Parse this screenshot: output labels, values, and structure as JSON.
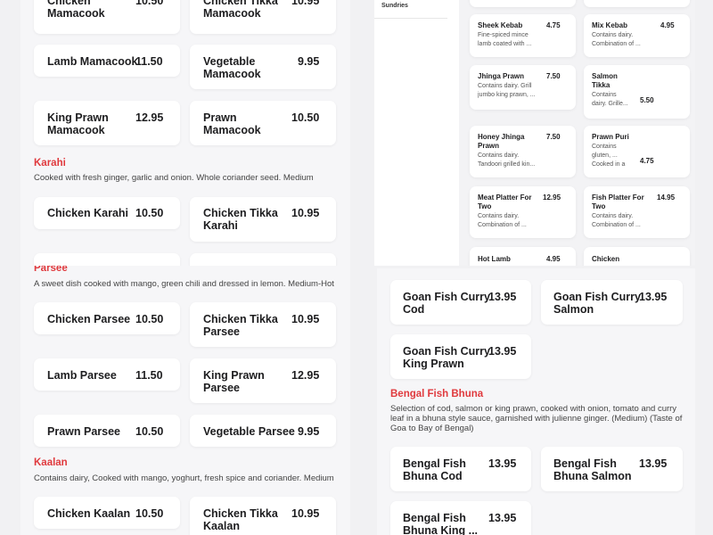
{
  "top_left": {
    "cards": [
      {
        "name": "Chicken\nMamacook",
        "price": "10.50"
      },
      {
        "name": "Chicken Tikka\nMamacook",
        "price": "10.95"
      },
      {
        "name": "Lamb Mamacook",
        "price": "11.50"
      },
      {
        "name": "Vegetable\nMamacook",
        "price": "9.95"
      },
      {
        "name": "King Prawn\nMamacook",
        "price": "12.95"
      },
      {
        "name": "Prawn\nMamacook",
        "price": "10.50"
      },
      {
        "name": "Chicken Karahi",
        "price": "10.50"
      },
      {
        "name": "Chicken Tikka\nKarahi",
        "price": "10.95"
      }
    ],
    "karahi": {
      "title": "Karahi",
      "desc": "Cooked with fresh ginger, garlic and onion. Whole coriander seed. Medium"
    }
  },
  "nav": {
    "item": "Sundries"
  },
  "top_right": {
    "cards": [
      {
        "name": "Sheek Kebab",
        "price": "4.75",
        "desc": "Fine-spiced mince\nlamb coated with ..."
      },
      {
        "name": "Mix Kebab",
        "price": "4.95",
        "desc": "Contains dairy.\nCombination of ..."
      },
      {
        "name": "Jhinga Prawn",
        "price": "7.50",
        "desc": "Contains dairy. Grill\njumbo king prawn, ..."
      },
      {
        "name": "Salmon\nTikka",
        "price": "5.50",
        "desc": "Contains\ndairy. Grille..."
      },
      {
        "name": "Honey Jhinga\nPrawn",
        "price": "7.50",
        "desc": "Contains dairy.\nTandoori grilled kin..."
      },
      {
        "name": "Prawn Puri",
        "price": "4.75",
        "desc": "Contains\ngluten, ...\nCooked in a"
      },
      {
        "name": "Meat Platter For\nTwo",
        "price": "12.95",
        "desc": "Contains dairy.\nCombination of ..."
      },
      {
        "name": "Fish Platter For\nTwo",
        "price": "14.95",
        "desc": "Contains dairy.\nCombination of ..."
      },
      {
        "name": "Hot Lamb",
        "price": "4.95",
        "desc": ""
      },
      {
        "name": "Chicken",
        "price": "",
        "desc": ""
      }
    ]
  },
  "bottom_left": {
    "parsee": {
      "title": "Parsee",
      "desc": "A sweet dish cooked with mango, green chili and dressed in lemon. Medium-Hot"
    },
    "cards": [
      {
        "name": "Chicken Parsee",
        "price": "10.50"
      },
      {
        "name": "Chicken Tikka\nParsee",
        "price": "10.95"
      },
      {
        "name": "Lamb Parsee",
        "price": "11.50"
      },
      {
        "name": "King Prawn\nParsee",
        "price": "12.95"
      },
      {
        "name": "Prawn Parsee",
        "price": "10.50"
      },
      {
        "name": "Vegetable Parsee",
        "price": "9.95"
      },
      {
        "name": "Chicken Kaalan",
        "price": "10.50"
      },
      {
        "name": "Chicken Tikka\nKaalan",
        "price": "10.95"
      }
    ],
    "kaalan": {
      "title": "Kaalan",
      "desc": "Contains dairy, Cooked with mango, yoghurt, fresh spice and coriander. Medium"
    }
  },
  "bottom_right": {
    "cards": [
      {
        "name": "Goan Fish Curry\nCod",
        "price": "13.95"
      },
      {
        "name": "Goan Fish Curry\nSalmon",
        "price": "13.95"
      },
      {
        "name": "Goan Fish Curry\nKing Prawn",
        "price": "13.95"
      },
      {
        "name": "Bengal Fish\nBhuna Cod",
        "price": "13.95"
      },
      {
        "name": "Bengal Fish\nBhuna Salmon",
        "price": "13.95"
      },
      {
        "name": "Bengal Fish\nBhuna King ...",
        "price": "13.95"
      }
    ],
    "bengal": {
      "title": "Bengal Fish Bhuna",
      "desc": "Selection of cod, salmon or king prawn, cooked with onion, tomato and curry leaf in a bhuna style sauce, garnished with julienne ginger. (Medium) (Taste of Goa to Bay of Bengal)"
    }
  }
}
